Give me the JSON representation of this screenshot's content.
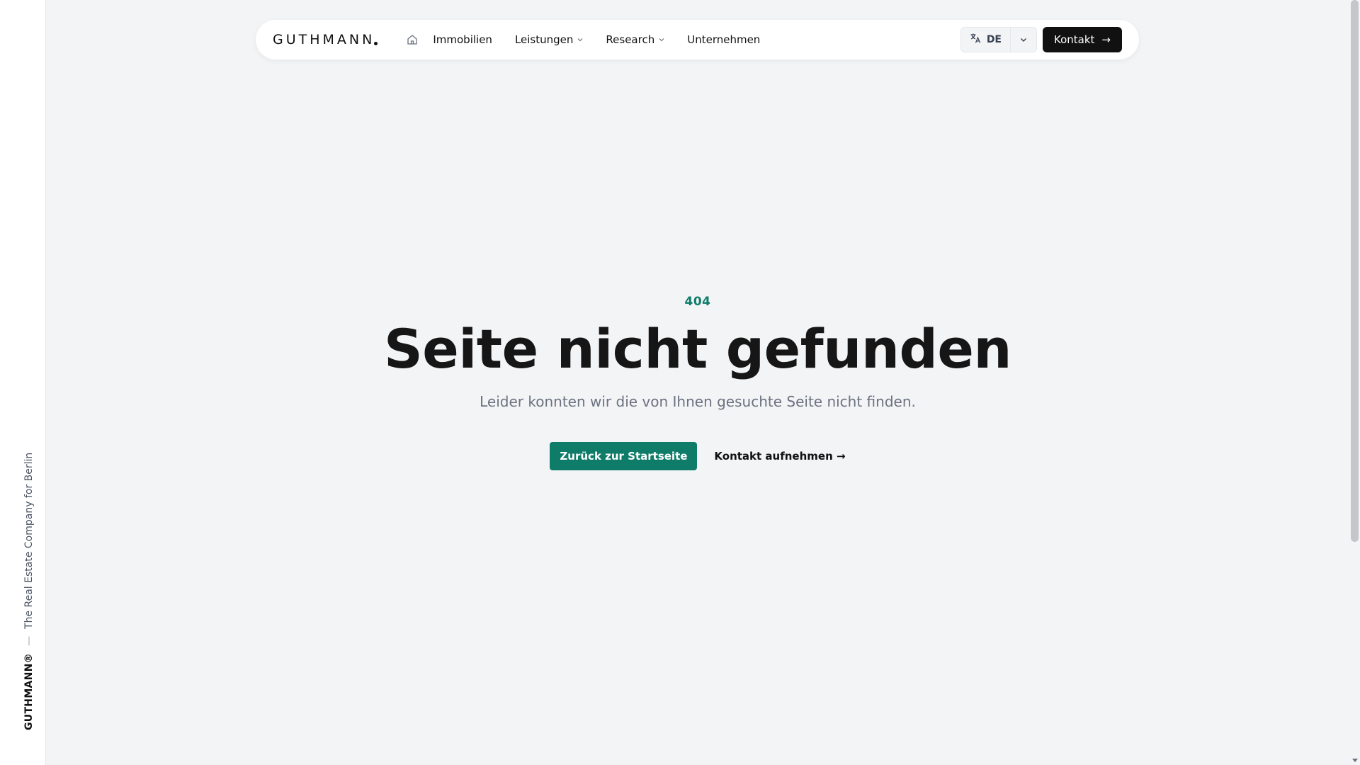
{
  "side": {
    "brand": "GUTHMANN®",
    "separator": "—",
    "tagline": "The Real Estate Company for Berlin"
  },
  "nav": {
    "logo": "GUTHMANN",
    "home_icon": "home-icon",
    "items": [
      {
        "label": "Immobilien",
        "dropdown": false
      },
      {
        "label": "Leistungen",
        "dropdown": true
      },
      {
        "label": "Research",
        "dropdown": true
      },
      {
        "label": "Unternehmen",
        "dropdown": false
      }
    ],
    "language": {
      "icon": "translate-icon",
      "code": "DE"
    },
    "contact": {
      "label": "Kontakt",
      "arrow": "→"
    }
  },
  "hero": {
    "code": "404",
    "title": "Seite nicht gefunden",
    "subtitle": "Leider konnten wir die von Ihnen gesuchte Seite nicht finden.",
    "primary_action": "Zurück zur Startseite",
    "secondary_action": "Kontakt aufnehmen →"
  },
  "colors": {
    "accent": "#0f7c6a",
    "background": "#f3f4f6",
    "dark": "#111111"
  }
}
